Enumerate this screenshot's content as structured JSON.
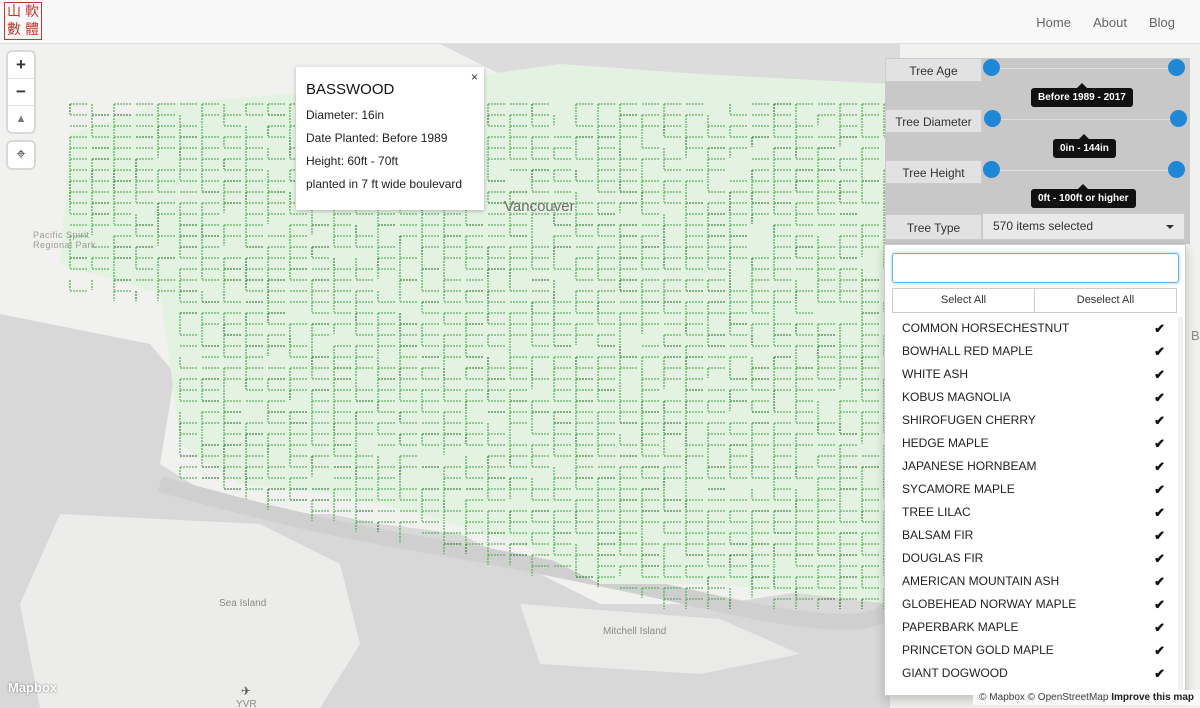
{
  "navbar": {
    "logo_chars": [
      "山",
      "軟",
      "數",
      "體"
    ],
    "links": [
      "Home",
      "About",
      "Blog"
    ]
  },
  "map": {
    "labels": {
      "city": "Vancouver",
      "park": "Pacific Spirit\nRegional Park",
      "sea_island": "Sea Island",
      "mitchell_island": "Mitchell Island",
      "yvr": "YVR"
    },
    "controls": {
      "zoom_in": "+",
      "zoom_out": "−",
      "compass": "▲"
    },
    "colors": {
      "trees": "#4caf50",
      "trees_dark": "#2e7d32",
      "water": "#d6d6d6",
      "land": "#f1f1ef"
    }
  },
  "popup": {
    "close": "×",
    "name": "BASSWOOD",
    "diameter": "Diameter: 16in",
    "date_planted": "Date Planted: Before 1989",
    "height": "Height: 60ft - 70ft",
    "note": "planted in 7 ft wide boulevard"
  },
  "filters": {
    "age": {
      "label": "Tree Age",
      "range_text": "Before 1989 - 2017"
    },
    "diameter": {
      "label": "Tree Diameter",
      "range_text": "0in - 144in"
    },
    "height": {
      "label": "Tree Height",
      "range_text": "0ft - 100ft or higher"
    },
    "type": {
      "label": "Tree Type",
      "selected_text": "570 items selected"
    }
  },
  "dropdown": {
    "search_placeholder": "",
    "select_all": "Select All",
    "deselect_all": "Deselect All",
    "items": [
      "COMMON HORSECHESTNUT",
      "BOWHALL RED MAPLE",
      "WHITE ASH",
      "KOBUS MAGNOLIA",
      "SHIROFUGEN CHERRY",
      "HEDGE MAPLE",
      "JAPANESE HORNBEAM",
      "SYCAMORE MAPLE",
      "TREE LILAC",
      "BALSAM FIR",
      "DOUGLAS FIR",
      "AMERICAN MOUNTAIN ASH",
      "GLOBEHEAD NORWAY MAPLE",
      "PAPERBARK MAPLE",
      "PRINCETON GOLD MAPLE",
      "GIANT DOGWOOD"
    ]
  },
  "attribution": {
    "mapbox_logo": "Mapbox",
    "text": "© Mapbox © OpenStreetMap",
    "improve": "Improve this map"
  }
}
